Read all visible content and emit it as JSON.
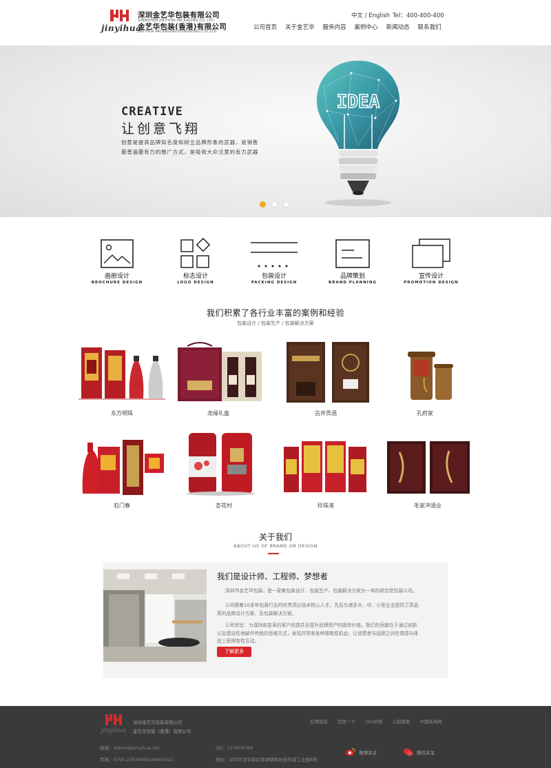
{
  "header": {
    "logo_latin": "jinyihua",
    "company_cn_1": "深圳金艺华包装有限公司",
    "company_en_1": "SHENZHEN JINYIHUA PACKAGING CO.,LTD",
    "company_cn_2": "金艺华包装(香港)有限公司",
    "company_en_2": "JINYIHUA PACKAGING(HONGKONG) CO.,LTD",
    "lang": "中文 / English",
    "tel": "Tel：400-400-400",
    "nav": [
      "公司首页",
      "关于金艺华",
      "服务内容",
      "案例中心",
      "新闻动态",
      "联系我们"
    ]
  },
  "banner": {
    "creative": "CREATIVE",
    "slogan": "让创意飞翔",
    "desc_line1": "创意是提高品牌知名度和树立品牌形象的武器，是销售",
    "desc_line2": "最普遍最有力的推广方式，是吸收大众注意的有力武器",
    "bulb_text": "IDEA",
    "slides": 3,
    "active_slide": 1
  },
  "services": [
    {
      "cn": "画册设计",
      "en": "BROCHURE DESIGN",
      "icon": "image-frame-icon"
    },
    {
      "cn": "标志设计",
      "en": "LOGO DESIGN",
      "icon": "logo-grid-icon"
    },
    {
      "cn": "包装设计",
      "en": "PACKING DESIGN",
      "icon": "packing-lines-icon"
    },
    {
      "cn": "品牌策划",
      "en": "BRAND PLANNING",
      "icon": "brand-card-icon"
    },
    {
      "cn": "宣传设计",
      "en": "PROMOTION DESIGN",
      "icon": "stacked-cards-icon"
    }
  ],
  "cases": {
    "title": "我们积累了各行业丰富的案例和经验",
    "subtitle": "包装设计 / 包装生产 / 包装解决方案",
    "items": [
      "东方明珠",
      "龙缘礼盒",
      "古井贡酒",
      "孔府家",
      "石门春",
      "杏花村",
      "珍珠液",
      "毛家冲酒业"
    ]
  },
  "about": {
    "title": "关于我们",
    "subtitle": "ABOUT US OF BRAND OR DESIGN",
    "heading": "我们是设计师、工程师、梦想者",
    "p1": "深圳市金艺华包装，是一家集包装设计、包装生产、包装解决方案为一体的综合型包装公司。",
    "p2a": "公司聚集10多年包装行业的优秀顶尖技术核心人才。先后为诸多大、中、小型企业提供了高品",
    "p2b": "质的品牌设计方案、及包装解决方案。",
    "p3a": "公司宗旨：为谋尚和变革的客户创造并且提升品牌资产的固有价值。我们的贡献在于通过创新",
    "p3b": "以及建设性地破坏传统的思维方式，发现并带来各种策略性机会，让消费者与品牌之间在情感与体",
    "p3c": "验上获得有性互动。",
    "more": "了解更多"
  },
  "footer": {
    "logo_text": "jinyihua",
    "co_1": "深圳金艺华包装有限公司",
    "co_2": "金艺华包装（香港）有限公司",
    "links": [
      "友情链接",
      "百度一下",
      "360好搜",
      "火狐搜索",
      "中国新闻网"
    ],
    "email": "邮箱：admin@yinyihua.net",
    "fax": "传真：0755-27976830/36605321",
    "qq": "QQ：123456789",
    "address": "地址：深圳市龙华新区观澜镇樟坑径东城工业园B栋",
    "weibo": "微博关注",
    "wechat": "微信关注"
  },
  "colors": {
    "accent_red": "#d9252a",
    "active_dot": "#f0a818",
    "footer_bg": "#3a3a3a"
  }
}
